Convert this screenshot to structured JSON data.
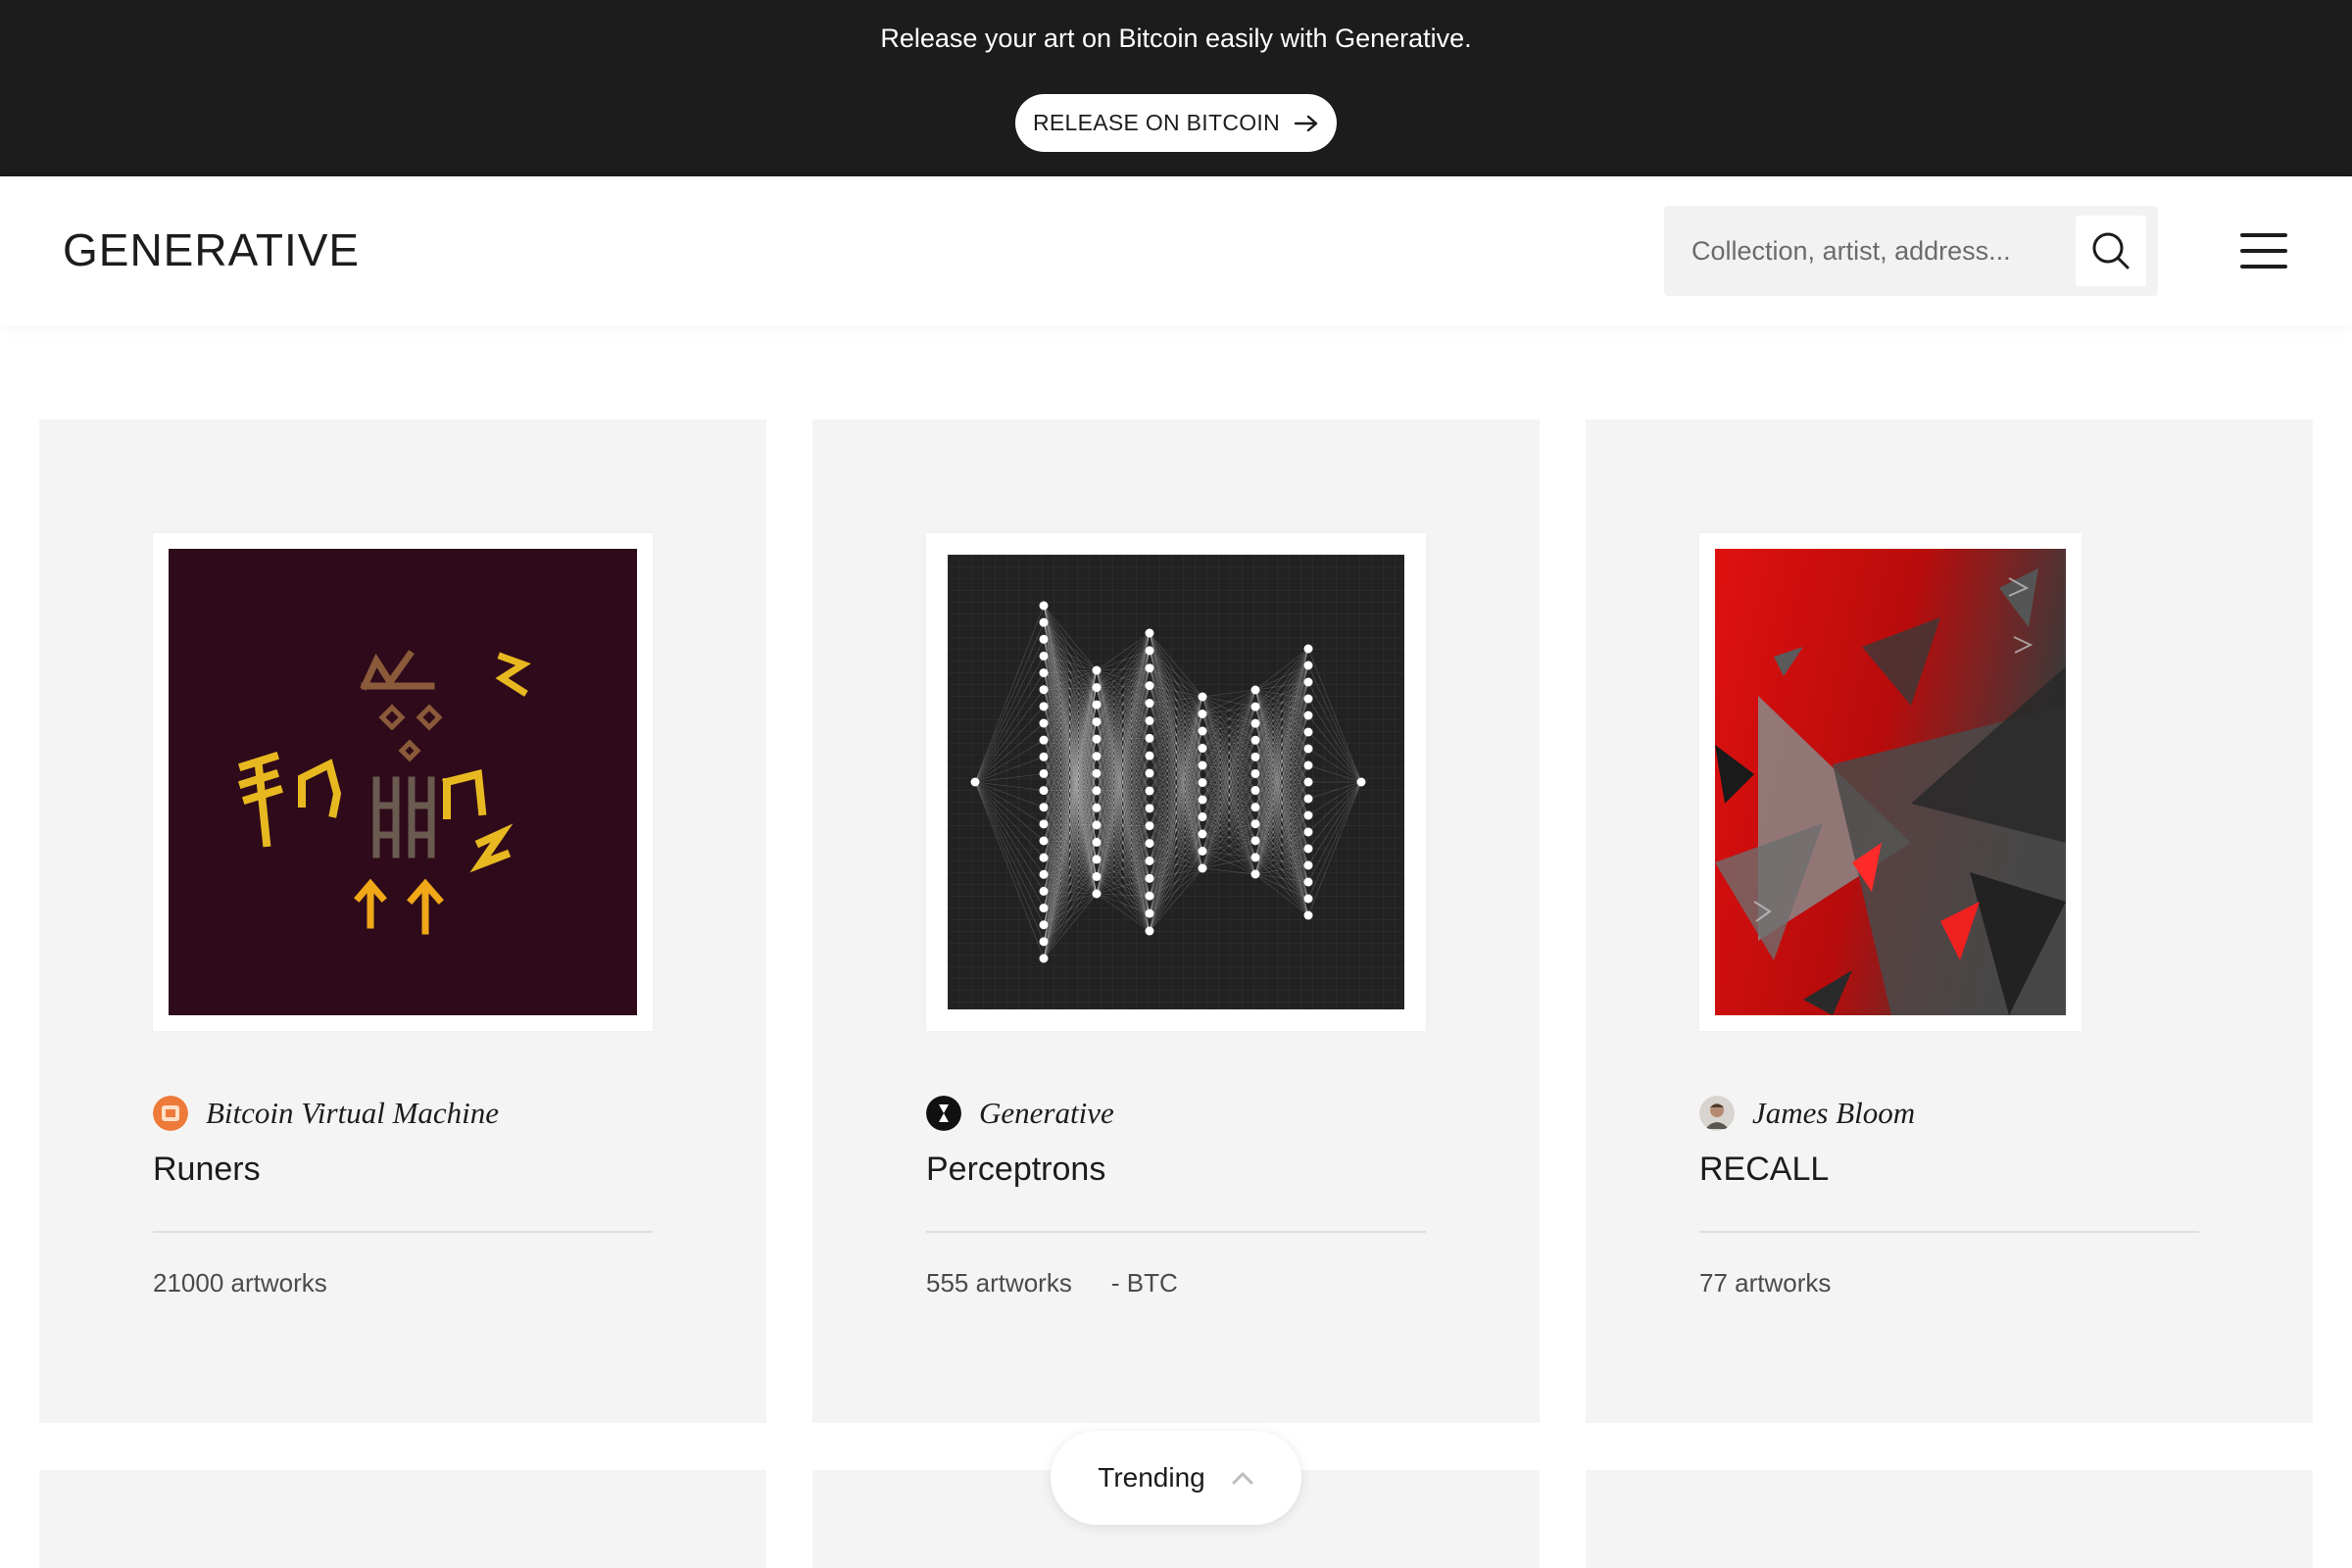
{
  "banner": {
    "text": "Release your art on Bitcoin easily with Generative.",
    "button_label": "RELEASE ON BITCOIN"
  },
  "header": {
    "logo": "GENERATIVE",
    "search_placeholder": "Collection, artist, address..."
  },
  "collections": [
    {
      "artist": "Bitcoin Virtual Machine",
      "title": "Runers",
      "artworks": "21000 artworks",
      "price": ""
    },
    {
      "artist": "Generative",
      "title": "Perceptrons",
      "artworks": "555 artworks",
      "price": "- BTC"
    },
    {
      "artist": "James Bloom",
      "title": "RECALL",
      "artworks": "77 artworks",
      "price": ""
    }
  ],
  "sort": {
    "label": "Trending"
  },
  "colors": {
    "banner_bg": "#1c1c1c",
    "card_bg": "#f4f4f4",
    "runers_bg": "#2e0a1a",
    "recall_red": "#d81010"
  }
}
